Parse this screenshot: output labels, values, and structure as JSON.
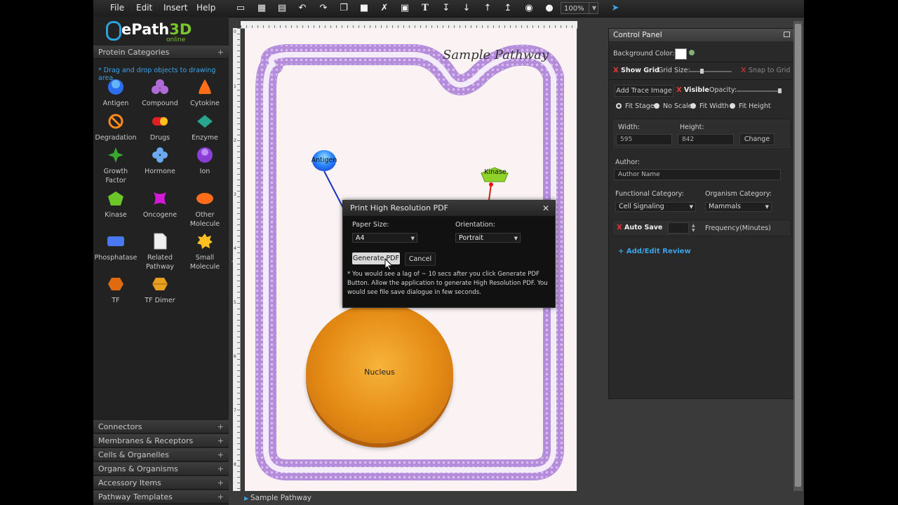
{
  "menu": [
    "File",
    "Edit",
    "Insert",
    "Help"
  ],
  "toolbar": {
    "icons": [
      "new-file-icon",
      "open-folder-icon",
      "save-icon",
      "undo-icon",
      "redo-icon",
      "copy-icon",
      "paste-icon",
      "cut-icon",
      "image-icon",
      "text-icon",
      "send-backward-icon",
      "move-down-icon",
      "bring-forward-icon",
      "bring-to-front-icon",
      "preview-eye-icon",
      "users-icon"
    ],
    "zoom": "100%",
    "exit_icon": "exit-icon"
  },
  "logo": {
    "main": "ePath",
    "accent": "3D",
    "sub": "online"
  },
  "left_panel": {
    "category_title": "Protein Categories",
    "hint": "* Drag and drop objects to drawing area.",
    "items": [
      {
        "label": "Antigen",
        "icon": "antigen-icon"
      },
      {
        "label": "Compound",
        "icon": "compound-icon"
      },
      {
        "label": "Cytokine",
        "icon": "cytokine-icon"
      },
      {
        "label": "Degradation",
        "icon": "degradation-icon"
      },
      {
        "label": "Drugs",
        "icon": "drugs-icon"
      },
      {
        "label": "Enzyme",
        "icon": "enzyme-icon"
      },
      {
        "label": "Growth Factor",
        "icon": "growth-factor-icon"
      },
      {
        "label": "Hormone",
        "icon": "hormone-icon"
      },
      {
        "label": "Ion",
        "icon": "ion-icon"
      },
      {
        "label": "Kinase",
        "icon": "kinase-icon"
      },
      {
        "label": "Oncogene",
        "icon": "oncogene-icon"
      },
      {
        "label": "Other Molecule",
        "icon": "other-molecule-icon"
      },
      {
        "label": "Phosphatase",
        "icon": "phosphatase-icon"
      },
      {
        "label": "Related Pathway",
        "icon": "related-pathway-icon"
      },
      {
        "label": "Small Molecule",
        "icon": "small-molecule-icon"
      },
      {
        "label": "TF",
        "icon": "tf-icon"
      },
      {
        "label": "TF Dimer",
        "icon": "tf-dimer-icon"
      }
    ],
    "bottom_categories": [
      "Connectors",
      "Membranes & Receptors",
      "Cells & Organelles",
      "Organs & Organisms",
      "Accessory Items",
      "Pathway Templates"
    ]
  },
  "canvas": {
    "title": "Sample Pathway",
    "nucleus": "Nucleus",
    "antigen": "Antigen",
    "kinase": "Kinase",
    "ruler_numbers": [
      "0",
      "1",
      "2",
      "3",
      "4",
      "5",
      "6",
      "7",
      "8"
    ]
  },
  "status": {
    "page": "Sample Pathway"
  },
  "dialog": {
    "title": "Print High Resolution PDF",
    "paper_label": "Paper Size:",
    "paper_value": "A4",
    "orientation_label": "Orientation:",
    "orientation_value": "Portrait",
    "generate": "Generate PDF",
    "cancel": "Cancel",
    "note": "* You would see a lag of ~ 10 secs after you click Generate PDF Button. Allow the application to generate High Resolution PDF. You would see file save dialogue in few seconds."
  },
  "control_panel": {
    "title": "Control Panel",
    "bg_label": "Background Color:",
    "bg_color": "#ffffff",
    "show_grid": "Show Grid",
    "grid_size": "Grid Size:",
    "snap": "Snap to Grid",
    "add_trace": "Add Trace Image",
    "visible": "Visible",
    "opacity": "Opacity:",
    "fit_options": [
      "Fit Stage",
      "No Scale",
      "Fit Width",
      "Fit Height"
    ],
    "fit_selected": "Fit Stage",
    "width_label": "Width:",
    "width_value": "595",
    "height_label": "Height:",
    "height_value": "842",
    "change": "Change",
    "author_label": "Author:",
    "author_placeholder": "Author Name",
    "func_label": "Functional Category:",
    "func_value": "Cell Signaling",
    "org_label": "Organism Category:",
    "org_value": "Mammals",
    "autosave": "Auto Save",
    "frequency": "Frequency(Minutes)",
    "review": "+ Add/Edit Review"
  }
}
